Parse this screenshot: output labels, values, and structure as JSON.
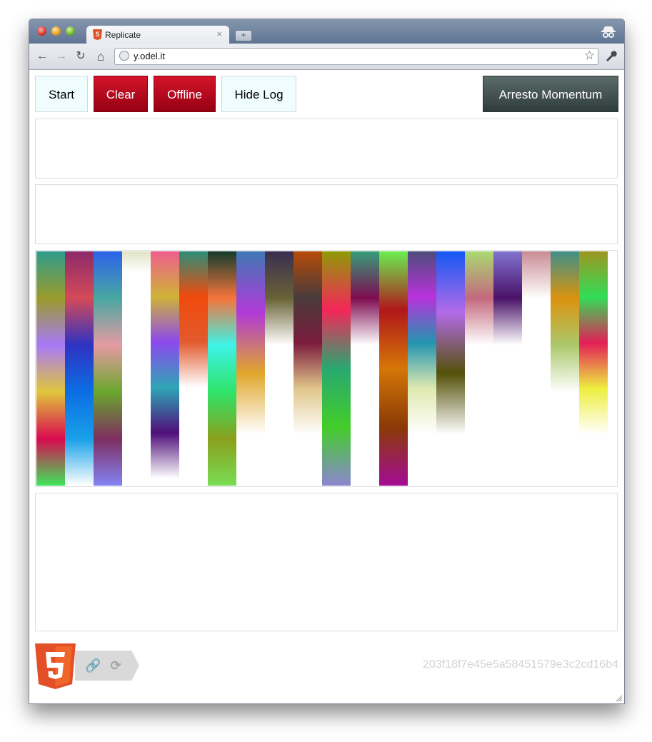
{
  "browser": {
    "tab_title": "Replicate",
    "tab_favicon": "html5-icon",
    "tab_close": "×",
    "new_tab": "+",
    "url": "y.odel.it",
    "back": "←",
    "forward": "→",
    "reload": "↻",
    "home": "⌂",
    "bookmark": "☆",
    "settings": "🔧"
  },
  "toolbar": {
    "start_label": "Start",
    "clear_label": "Clear",
    "offline_label": "Offline",
    "hide_log_label": "Hide Log",
    "arresto_label": "Arresto Momentum"
  },
  "colors": {
    "accent_red": "#c0001c",
    "light_button": "#effdfe",
    "dark_button": "#3d4b4b"
  },
  "bars": [
    {
      "stops": [
        "#2f9c8c",
        "#9a9b2c",
        "#a779f7",
        "#e0c63c",
        "#d90a4f",
        "#3ee45a"
      ],
      "fill": 1.0
    },
    {
      "stops": [
        "#8d2a6a",
        "#d44a58",
        "#2e32c2",
        "#0c6ee4",
        "#18a0e8",
        "#ffffff"
      ],
      "fill": 1.0
    },
    {
      "stops": [
        "#2c62e8",
        "#48a7a2",
        "#e59ba3",
        "#6aa62c",
        "#7e2e60",
        "#8483f5"
      ],
      "fill": 1.0
    },
    {
      "stops": [
        "#e0e4c4",
        "#ffffff",
        "#ffffff"
      ],
      "fill": 0.18
    },
    {
      "stops": [
        "#ef5e8d",
        "#cfb237",
        "#8c49ee",
        "#2fa5b6",
        "#4f0f7a",
        "#ffffff"
      ],
      "fill": 0.97
    },
    {
      "stops": [
        "#2b8e77",
        "#f04a0c",
        "#e25a2d",
        "#ffffff"
      ],
      "fill": 0.58
    },
    {
      "stops": [
        "#133c2e",
        "#f6743b",
        "#3ef3e8",
        "#2ee46a",
        "#8aa01c",
        "#7adc55"
      ],
      "fill": 1.0
    },
    {
      "stops": [
        "#3f78b4",
        "#b03ad8",
        "#e0a62c",
        "#ffffff"
      ],
      "fill": 0.78
    },
    {
      "stops": [
        "#3a2e50",
        "#696236",
        "#ffffff"
      ],
      "fill": 0.4
    },
    {
      "stops": [
        "#b74b09",
        "#4a3b3b",
        "#7b1b3c",
        "#e0c58a",
        "#ffffff"
      ],
      "fill": 0.78
    },
    {
      "stops": [
        "#8f9a08",
        "#f42659",
        "#28a870",
        "#43cd2a",
        "#8b86d0"
      ],
      "fill": 1.0
    },
    {
      "stops": [
        "#369d79",
        "#7e0c50",
        "#ffffff"
      ],
      "fill": 0.4
    },
    {
      "stops": [
        "#6bee51",
        "#b0171b",
        "#d57608",
        "#8a3a06",
        "#a40c95"
      ],
      "fill": 1.0
    },
    {
      "stops": [
        "#4d4c7c",
        "#b832db",
        "#2494b0",
        "#dfeab0",
        "#ffffff"
      ],
      "fill": 0.78
    },
    {
      "stops": [
        "#1458f4",
        "#b36ae8",
        "#535109",
        "#ffffff"
      ],
      "fill": 0.78
    },
    {
      "stops": [
        "#a9da71",
        "#c4697d",
        "#ffffff"
      ],
      "fill": 0.4
    },
    {
      "stops": [
        "#8173cf",
        "#4a1268",
        "#ffffff"
      ],
      "fill": 0.4
    },
    {
      "stops": [
        "#c98c94",
        "#ffffff"
      ],
      "fill": 0.2
    },
    {
      "stops": [
        "#3e8f88",
        "#da930f",
        "#abc86b",
        "#ffffff"
      ],
      "fill": 0.6
    },
    {
      "stops": [
        "#9e9521",
        "#32dd56",
        "#e31f57",
        "#eeee3f",
        "#ffffff"
      ],
      "fill": 0.78
    }
  ],
  "footer": {
    "badge_icon_1": "🔗",
    "badge_icon_2": "⟳",
    "hash": "203f18f7e45e5a58451579e3c2cd16b4"
  }
}
